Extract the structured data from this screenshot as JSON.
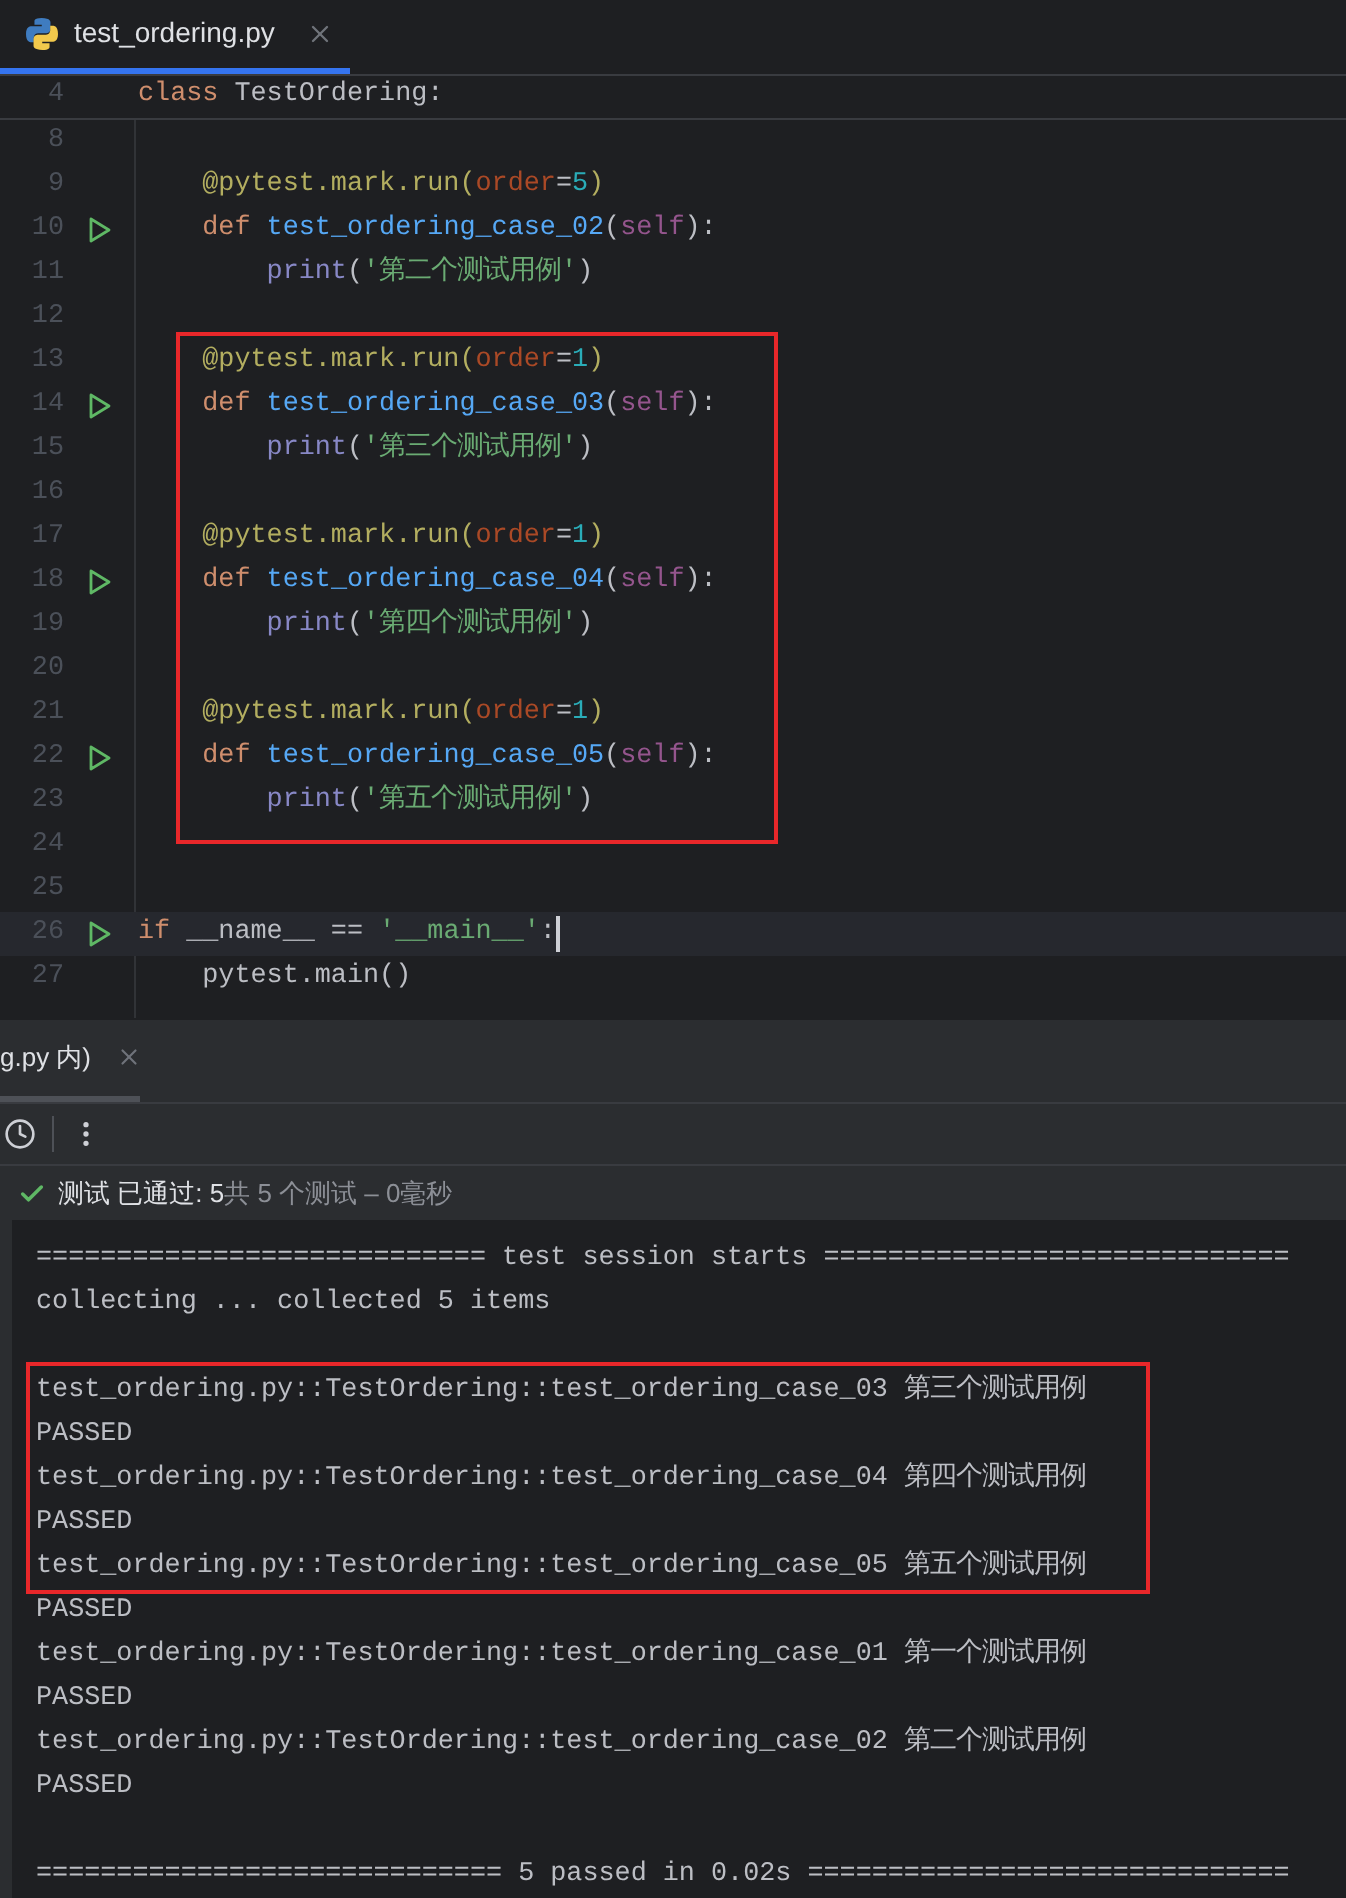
{
  "file_tab": {
    "label": "test_ordering.py",
    "selected": true
  },
  "sticky_line": {
    "number": "4",
    "tokens": [
      {
        "kind": "keyword",
        "text": "class "
      },
      {
        "kind": "plain",
        "text": "TestOrdering:"
      }
    ]
  },
  "code_groups": [
    {
      "framed": false,
      "lines": [
        {
          "number": "8",
          "run": false,
          "current": false
        },
        {
          "number": "9",
          "run": false,
          "current": false,
          "tokens": [
            {
              "kind": "decorator",
              "text": "    @pytest.mark.run("
            },
            {
              "kind": "param",
              "text": "order"
            },
            {
              "kind": "plain",
              "text": "="
            },
            {
              "kind": "number",
              "text": "5"
            },
            {
              "kind": "decorator",
              "text": ")"
            }
          ]
        },
        {
          "number": "10",
          "run": true,
          "current": false,
          "tokens": [
            {
              "kind": "keyword",
              "text": "    def "
            },
            {
              "kind": "function",
              "text": "test_ordering_case_02"
            },
            {
              "kind": "plain",
              "text": "("
            },
            {
              "kind": "self",
              "text": "self"
            },
            {
              "kind": "plain",
              "text": "):"
            }
          ]
        },
        {
          "number": "11",
          "run": false,
          "current": false,
          "tokens": [
            {
              "kind": "builtin",
              "text": "        print"
            },
            {
              "kind": "plain",
              "text": "("
            },
            {
              "kind": "string",
              "text": "'第二个测试用例'"
            },
            {
              "kind": "plain",
              "text": ")"
            }
          ]
        },
        {
          "number": "12",
          "run": false,
          "current": false
        }
      ]
    },
    {
      "framed": true,
      "lines": [
        {
          "number": "13",
          "run": false,
          "current": false,
          "tokens": [
            {
              "kind": "decorator",
              "text": "    @pytest.mark.run("
            },
            {
              "kind": "param",
              "text": "order"
            },
            {
              "kind": "plain",
              "text": "="
            },
            {
              "kind": "number",
              "text": "1"
            },
            {
              "kind": "decorator",
              "text": ")"
            }
          ]
        },
        {
          "number": "14",
          "run": true,
          "current": false,
          "tokens": [
            {
              "kind": "keyword",
              "text": "    def "
            },
            {
              "kind": "function",
              "text": "test_ordering_case_03"
            },
            {
              "kind": "plain",
              "text": "("
            },
            {
              "kind": "self",
              "text": "self"
            },
            {
              "kind": "plain",
              "text": "):"
            }
          ]
        },
        {
          "number": "15",
          "run": false,
          "current": false,
          "tokens": [
            {
              "kind": "builtin",
              "text": "        print"
            },
            {
              "kind": "plain",
              "text": "("
            },
            {
              "kind": "string",
              "text": "'第三个测试用例'"
            },
            {
              "kind": "plain",
              "text": ")"
            }
          ]
        },
        {
          "number": "16",
          "run": false,
          "current": false
        },
        {
          "number": "17",
          "run": false,
          "current": false,
          "tokens": [
            {
              "kind": "decorator",
              "text": "    @pytest.mark.run("
            },
            {
              "kind": "param",
              "text": "order"
            },
            {
              "kind": "plain",
              "text": "="
            },
            {
              "kind": "number",
              "text": "1"
            },
            {
              "kind": "decorator",
              "text": ")"
            }
          ]
        },
        {
          "number": "18",
          "run": true,
          "current": false,
          "tokens": [
            {
              "kind": "keyword",
              "text": "    def "
            },
            {
              "kind": "function",
              "text": "test_ordering_case_04"
            },
            {
              "kind": "plain",
              "text": "("
            },
            {
              "kind": "self",
              "text": "self"
            },
            {
              "kind": "plain",
              "text": "):"
            }
          ]
        },
        {
          "number": "19",
          "run": false,
          "current": false,
          "tokens": [
            {
              "kind": "builtin",
              "text": "        print"
            },
            {
              "kind": "plain",
              "text": "("
            },
            {
              "kind": "string",
              "text": "'第四个测试用例'"
            },
            {
              "kind": "plain",
              "text": ")"
            }
          ]
        },
        {
          "number": "20",
          "run": false,
          "current": false
        },
        {
          "number": "21",
          "run": false,
          "current": false,
          "tokens": [
            {
              "kind": "decorator",
              "text": "    @pytest.mark.run("
            },
            {
              "kind": "param",
              "text": "order"
            },
            {
              "kind": "plain",
              "text": "="
            },
            {
              "kind": "number",
              "text": "1"
            },
            {
              "kind": "decorator",
              "text": ")"
            }
          ]
        },
        {
          "number": "22",
          "run": true,
          "current": false,
          "tokens": [
            {
              "kind": "keyword",
              "text": "    def "
            },
            {
              "kind": "function",
              "text": "test_ordering_case_05"
            },
            {
              "kind": "plain",
              "text": "("
            },
            {
              "kind": "self",
              "text": "self"
            },
            {
              "kind": "plain",
              "text": "):"
            }
          ]
        },
        {
          "number": "23",
          "run": false,
          "current": false,
          "tokens": [
            {
              "kind": "builtin",
              "text": "        print"
            },
            {
              "kind": "plain",
              "text": "("
            },
            {
              "kind": "string",
              "text": "'第五个测试用例'"
            },
            {
              "kind": "plain",
              "text": ")"
            }
          ]
        }
      ]
    },
    {
      "framed": false,
      "lines": [
        {
          "number": "24",
          "run": false,
          "current": false
        },
        {
          "number": "25",
          "run": false,
          "current": false
        },
        {
          "number": "26",
          "run": true,
          "current": true,
          "tokens": [
            {
              "kind": "keyword",
              "text": "if "
            },
            {
              "kind": "plain",
              "text": "__name__ == "
            },
            {
              "kind": "string",
              "text": "'__main__'"
            },
            {
              "kind": "plain",
              "text": ":"
            }
          ]
        },
        {
          "number": "27",
          "run": false,
          "current": false,
          "tokens": [
            {
              "kind": "plain",
              "text": "    pytest.main()"
            }
          ]
        }
      ]
    }
  ],
  "run_tab": {
    "label": "g.py 内)",
    "selected": true
  },
  "status": {
    "label": "测试 已通过: 5",
    "detail": "共 5 个测试 – 0毫秒"
  },
  "console_groups": [
    {
      "framed": false,
      "lines": [
        {
          "kind": "text",
          "text": "============================ test session starts ============================="
        },
        {
          "kind": "text",
          "text": "collecting ... collected 5 items"
        },
        {
          "kind": "blank"
        }
      ]
    },
    {
      "framed": true,
      "lines": [
        {
          "kind": "text",
          "text": "test_ordering.py::TestOrdering::test_ordering_case_03 第三个测试用例"
        },
        {
          "kind": "text",
          "text": "PASSED"
        },
        {
          "kind": "text",
          "text": "test_ordering.py::TestOrdering::test_ordering_case_04 第四个测试用例"
        },
        {
          "kind": "text",
          "text": "PASSED"
        },
        {
          "kind": "text",
          "text": "test_ordering.py::TestOrdering::test_ordering_case_05 第五个测试用例"
        }
      ]
    },
    {
      "framed": false,
      "lines": [
        {
          "kind": "text",
          "text": "PASSED"
        },
        {
          "kind": "text",
          "text": "test_ordering.py::TestOrdering::test_ordering_case_01 第一个测试用例"
        },
        {
          "kind": "text",
          "text": "PASSED"
        },
        {
          "kind": "text",
          "text": "test_ordering.py::TestOrdering::test_ordering_case_02 第二个测试用例"
        },
        {
          "kind": "text",
          "text": "PASSED"
        },
        {
          "kind": "blank"
        },
        {
          "kind": "text",
          "text": "============================= 5 passed in 0.02s =============================="
        }
      ]
    }
  ]
}
